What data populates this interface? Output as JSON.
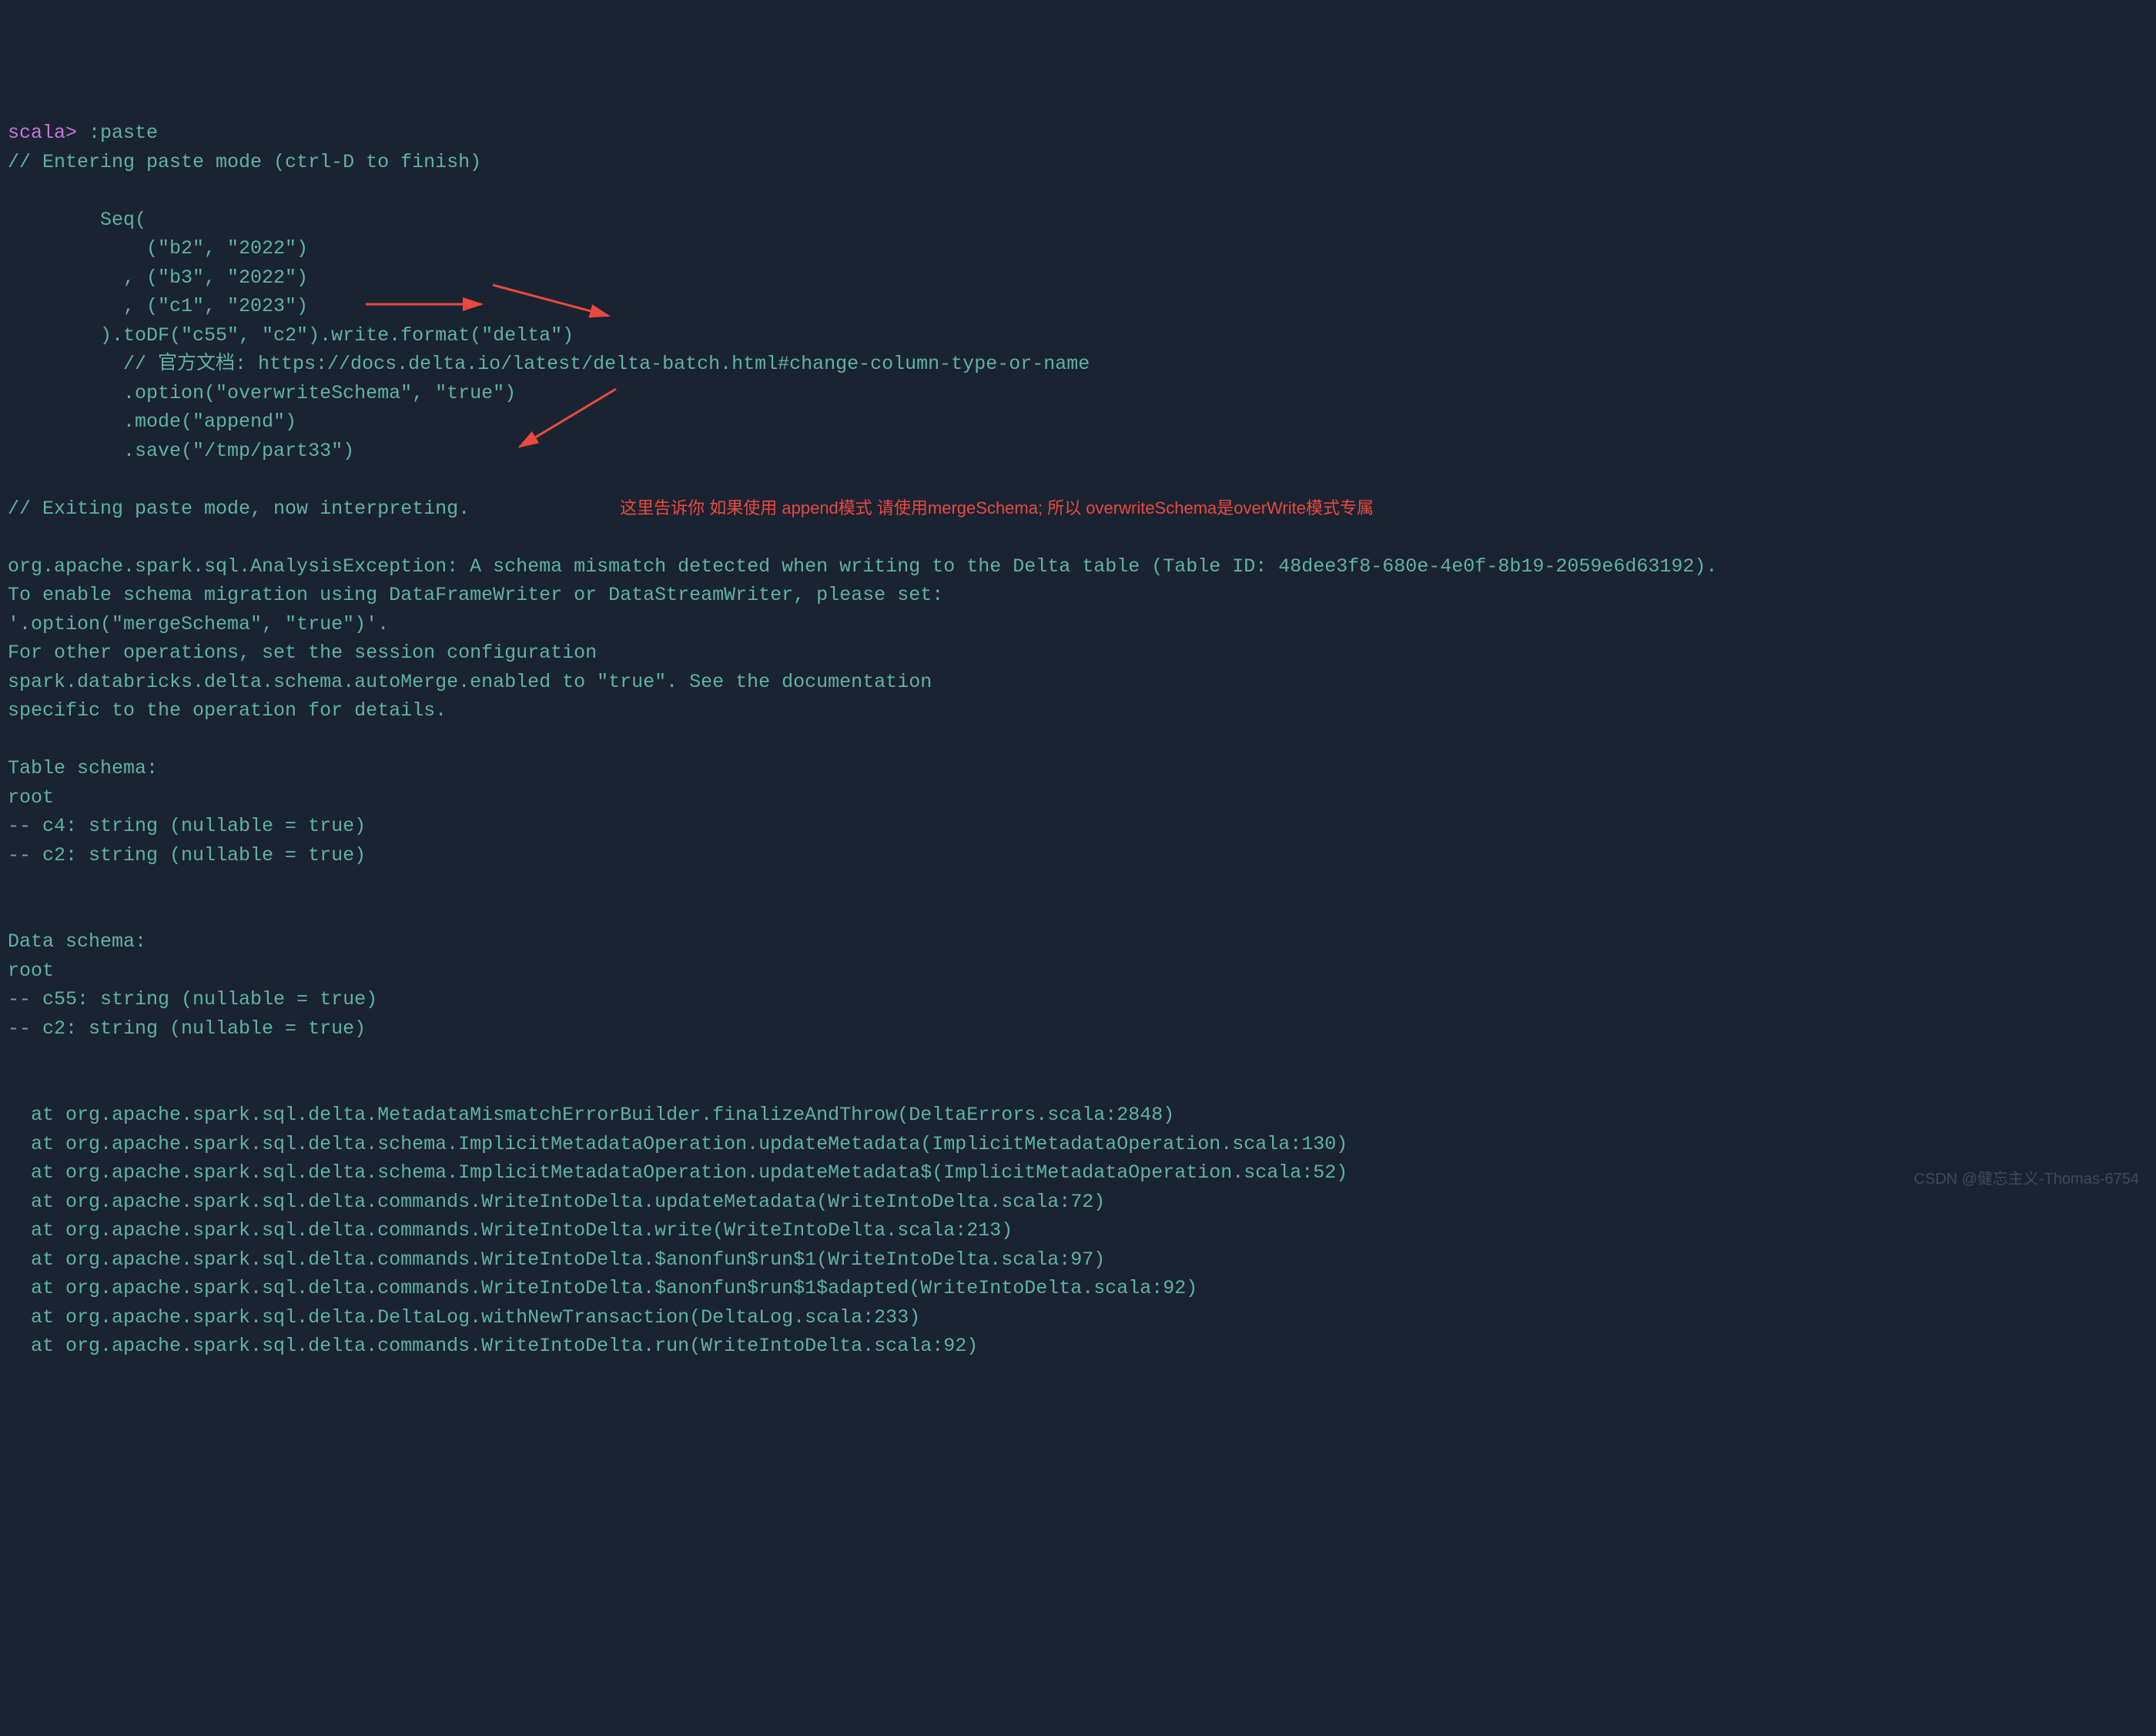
{
  "prompt": "scala>",
  "command": ":paste",
  "lines": {
    "l1": "// Entering paste mode (ctrl-D to finish)",
    "l2": "",
    "l3": "        Seq(",
    "l4": "            (\"b2\", \"2022\")",
    "l5": "          , (\"b3\", \"2022\")",
    "l6": "          , (\"c1\", \"2023\")",
    "l7": "        ).toDF(\"c55\", \"c2\").write.format(\"delta\")",
    "l8": "          // 官方文档: https://docs.delta.io/latest/delta-batch.html#change-column-type-or-name",
    "l9": "          .option(\"overwriteSchema\", \"true\")",
    "l10": "          .mode(\"append\")",
    "l11": "          .save(\"/tmp/part33\")",
    "l12": "",
    "l13": "// Exiting paste mode, now interpreting.",
    "l14": "",
    "l15": "org.apache.spark.sql.AnalysisException: A schema mismatch detected when writing to the Delta table (Table ID: 48dee3f8-680e-4e0f-8b19-2059e6d63192).",
    "l16": "To enable schema migration using DataFrameWriter or DataStreamWriter, please set:",
    "l17": "'.option(\"mergeSchema\", \"true\")'.",
    "l18": "For other operations, set the session configuration",
    "l19": "spark.databricks.delta.schema.autoMerge.enabled to \"true\". See the documentation",
    "l20": "specific to the operation for details.",
    "l21": "",
    "l22": "Table schema:",
    "l23": "root",
    "l24": "-- c4: string (nullable = true)",
    "l25": "-- c2: string (nullable = true)",
    "l26": "",
    "l27": "",
    "l28": "Data schema:",
    "l29": "root",
    "l30": "-- c55: string (nullable = true)",
    "l31": "-- c2: string (nullable = true)",
    "l32": "",
    "l33": "",
    "l34": "  at org.apache.spark.sql.delta.MetadataMismatchErrorBuilder.finalizeAndThrow(DeltaErrors.scala:2848)",
    "l35": "  at org.apache.spark.sql.delta.schema.ImplicitMetadataOperation.updateMetadata(ImplicitMetadataOperation.scala:130)",
    "l36": "  at org.apache.spark.sql.delta.schema.ImplicitMetadataOperation.updateMetadata$(ImplicitMetadataOperation.scala:52)",
    "l37": "  at org.apache.spark.sql.delta.commands.WriteIntoDelta.updateMetadata(WriteIntoDelta.scala:72)",
    "l38": "  at org.apache.spark.sql.delta.commands.WriteIntoDelta.write(WriteIntoDelta.scala:213)",
    "l39": "  at org.apache.spark.sql.delta.commands.WriteIntoDelta.$anonfun$run$1(WriteIntoDelta.scala:97)",
    "l40": "  at org.apache.spark.sql.delta.commands.WriteIntoDelta.$anonfun$run$1$adapted(WriteIntoDelta.scala:92)",
    "l41": "  at org.apache.spark.sql.delta.DeltaLog.withNewTransaction(DeltaLog.scala:233)",
    "l42": "  at org.apache.spark.sql.delta.commands.WriteIntoDelta.run(WriteIntoDelta.scala:92)"
  },
  "annotation": "这里告诉你 如果使用 append模式 请使用mergeSchema;   所以 overwriteSchema是overWrite模式专属",
  "watermark": "CSDN @健忘主义-Thomas-6754"
}
